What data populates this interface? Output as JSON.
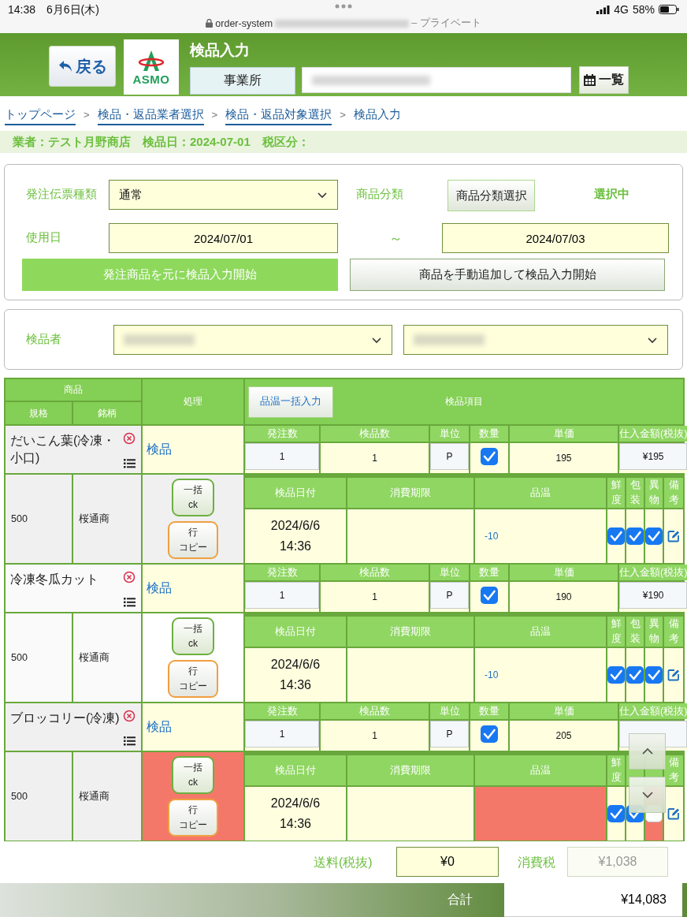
{
  "status_bar": {
    "time": "14:38",
    "date": "6月6日(木)",
    "url_start": "order-system",
    "url_end": "– プライベート",
    "network": "4G",
    "battery": "58%"
  },
  "header": {
    "back": "戻る",
    "logo": "ASMO",
    "title": "検品入力",
    "office_label": "事業所",
    "list_button": "一覧"
  },
  "breadcrumbs": [
    {
      "label": "トップページ",
      "link": true
    },
    {
      "separator": ">",
      "label": "検品・返品業者選択",
      "link": true
    },
    {
      "separator": ">",
      "label": "検品・返品対象選択",
      "link": true
    },
    {
      "separator": ">",
      "label": "検品入力",
      "link": false
    }
  ],
  "summary": "業者：テスト月野商店　検品日：2024-07-01　税区分：",
  "filters": {
    "slip_type_label": "発注伝票種類",
    "slip_type": "通常",
    "category_label": "商品分類",
    "category_button": "商品分類選択",
    "category_status": "選択中",
    "date_label": "使用日",
    "date_from": "2024/07/01",
    "range_sep": "～",
    "date_to": "2024/07/03",
    "start_from_order": "発注商品を元に検品入力開始",
    "start_manual": "商品を手動追加して検品入力開始"
  },
  "inspectors": {
    "label": "検品者"
  },
  "table": {
    "columns": {
      "product": "商品",
      "spec": "規格",
      "brand": "銘柄",
      "action": "処理",
      "bulk_temp": "品温一括入力",
      "items": "検品項目"
    },
    "rows": [
      {
        "name": "だいこん葉(冷凍・小口)",
        "shaded": true,
        "action": "検品",
        "order_headers": [
          "発注数",
          "検品数",
          "単位",
          "数量",
          "単価",
          "仕入金額(税抜)"
        ],
        "ordered": "1",
        "inspected": "1",
        "unit": "P",
        "qty_checked": true,
        "unit_price": "195",
        "amount": "¥195",
        "spec": "500",
        "brand": "桜通商",
        "bulk_ck": "一括\nck",
        "copy": [
          "行",
          "コピー"
        ],
        "needs_attention": false,
        "inspect_headers": [
          "検品日付",
          "消費期限",
          "品温"
        ],
        "date": "2024/6/6",
        "time": "14:36",
        "temperature": "-10",
        "temperature_missing": false,
        "checks": [
          {
            "label": "鮮度",
            "checked": true,
            "error": false
          },
          {
            "label": "包装",
            "checked": true,
            "error": false
          },
          {
            "label": "異物",
            "checked": true,
            "error": false
          }
        ],
        "note_label": "備考"
      },
      {
        "name": "冷凍冬瓜カット",
        "shaded": false,
        "action": "検品",
        "order_headers": [
          "発注数",
          "検品数",
          "単位",
          "数量",
          "単価",
          "仕入金額(税抜)"
        ],
        "ordered": "1",
        "inspected": "1",
        "unit": "P",
        "qty_checked": true,
        "unit_price": "190",
        "amount": "¥190",
        "spec": "500",
        "brand": "桜通商",
        "bulk_ck": "一括\nck",
        "copy": [
          "行",
          "コピー"
        ],
        "needs_attention": false,
        "inspect_headers": [
          "検品日付",
          "消費期限",
          "品温"
        ],
        "date": "2024/6/6",
        "time": "14:36",
        "temperature": "-10",
        "temperature_missing": false,
        "checks": [
          {
            "label": "鮮度",
            "checked": true,
            "error": false
          },
          {
            "label": "包装",
            "checked": true,
            "error": false
          },
          {
            "label": "異物",
            "checked": true,
            "error": false
          }
        ],
        "note_label": "備考"
      },
      {
        "name": "ブロッコリー(冷凍)",
        "shaded": true,
        "action": "検品",
        "order_headers": [
          "発注数",
          "検品数",
          "単位",
          "数量",
          "単価",
          "仕入金額(税抜)"
        ],
        "ordered": "1",
        "inspected": "1",
        "unit": "P",
        "qty_checked": true,
        "unit_price": "205",
        "spec": "500",
        "brand": "桜通商",
        "bulk_ck": "一括\nck",
        "copy": [
          "行",
          "コピー"
        ],
        "needs_attention": true,
        "inspect_headers": [
          "検品日付",
          "消費期限",
          "品温"
        ],
        "date": "2024/6/6",
        "time": "14:36",
        "temperature_missing": true,
        "checks": [
          {
            "label": "鮮度",
            "checked": true,
            "error": false
          },
          {
            "checked": true,
            "error": false
          },
          {
            "checked": false,
            "error": true
          }
        ],
        "note_label": "備考"
      }
    ]
  },
  "footer": {
    "shipping_label": "送料(税抜)",
    "shipping": "¥0",
    "tax_label": "消費税",
    "tax": "¥1,038",
    "total_label": "合計",
    "total": "¥14,083"
  }
}
